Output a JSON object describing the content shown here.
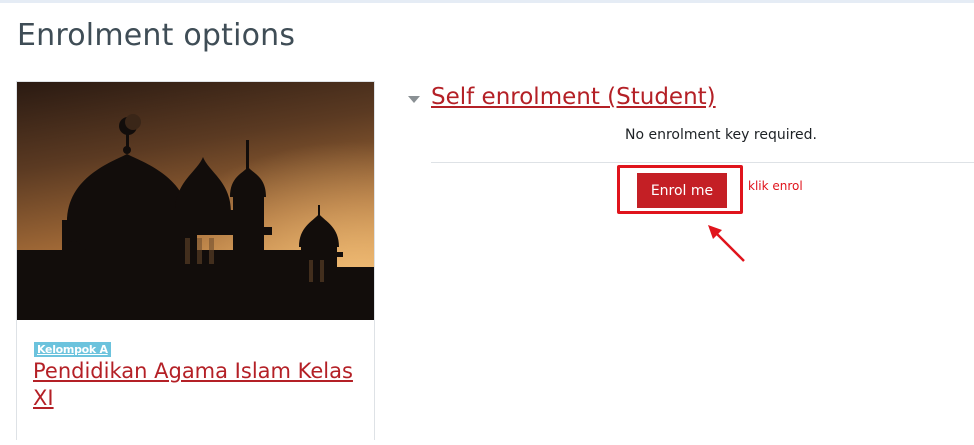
{
  "page": {
    "title": "Enrolment options"
  },
  "course": {
    "category": "Kelompok A",
    "title": "Pendidikan Agama Islam Kelas XI",
    "image_subject": "mosque-silhouette-sunset"
  },
  "enrolment": {
    "method_title": "Self enrolment (Student)",
    "info": "No enrolment key required.",
    "button_label": "Enrol me"
  },
  "annotation": {
    "text": "klik enrol"
  },
  "colors": {
    "link": "#b42026",
    "button": "#c41f25",
    "annotation": "#e0141c",
    "badge": "#6cc3dd",
    "heading": "#3f4d56"
  }
}
